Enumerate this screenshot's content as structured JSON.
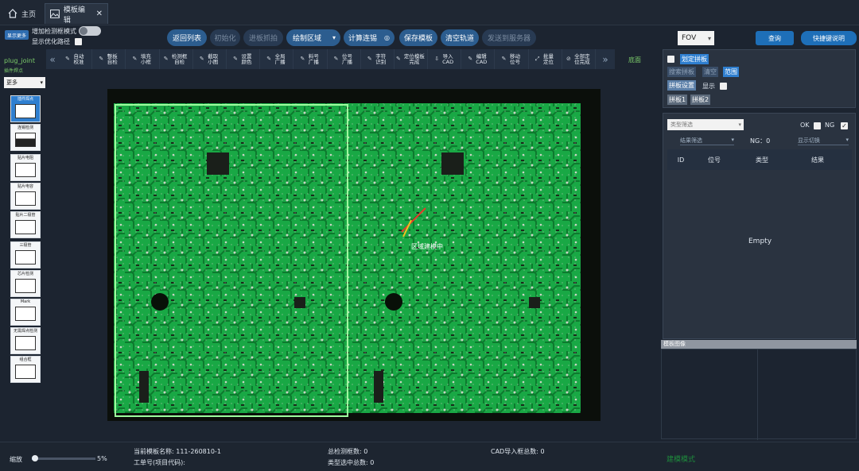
{
  "tabs": {
    "home": "主页",
    "edit": "模板编辑"
  },
  "top": {
    "show_more": "显示更多",
    "add_detect_mode": "增加检测框模式",
    "show_optimized_path": "显示优化路径",
    "pills": [
      "返回列表",
      "初始化",
      "进板抓拍",
      "绘制区域",
      "计算连锡",
      "保存模板",
      "清空轨道",
      "发送到服务器"
    ],
    "fov": "FOV",
    "query": "查询",
    "shortcut": "快捷键说明"
  },
  "left": {
    "plug_joint": "plug_joint",
    "insert_point": "插件焊点",
    "more": "更多",
    "components": [
      "插件焊点",
      "连锡检测",
      "贴片电阻",
      "贴片电容",
      "贴片二极管",
      "三极管",
      "芯片检测",
      "Mark",
      "无需焊点检测",
      "组合框"
    ]
  },
  "toolbar": {
    "items": [
      "自动校准",
      "整板自检",
      "填充小框",
      "检测框自检",
      "截取小图",
      "设置颜色",
      "全局广播",
      "料号广播",
      "位号广播",
      "字符识别",
      "定位模板完成",
      "导入CAD",
      "编辑CAD",
      "移动位号",
      "批量定位",
      "全部定位完成"
    ],
    "side": "底面"
  },
  "canvas": {
    "label": "区域建模中"
  },
  "right": {
    "draw_board": "划定拼板",
    "search_board": "搜索拼板",
    "clear": "清空",
    "range": "范围",
    "board_settings": "拼板设置",
    "display": "显示",
    "board1": "拼板1",
    "board2": "拼板2",
    "type_filter": "类型筛选",
    "ok": "OK",
    "ng": "NG",
    "result_filter": "结果筛选",
    "ng_count": "NG：0",
    "display_switch": "显示切换",
    "columns": [
      "ID",
      "位号",
      "类型",
      "结果"
    ],
    "empty": "Empty",
    "template_image": "模板图像"
  },
  "bottom": {
    "zoom_label": "缩放",
    "zoom_value": "5%",
    "zoom_fraction": 0.05,
    "template_name": "当前模板名称: 111-260810-1",
    "work_order": "工单号(项目代码):",
    "total_detect": "总检测框数: 0",
    "type_selected": "类型选中总数: 0",
    "cad_import": "CAD导入框总数: 0",
    "mode": "建模模式"
  },
  "colors": {
    "accent": "#2f7fd0",
    "pcb": "#1db34a",
    "mode_text": "#1e8a3c"
  }
}
